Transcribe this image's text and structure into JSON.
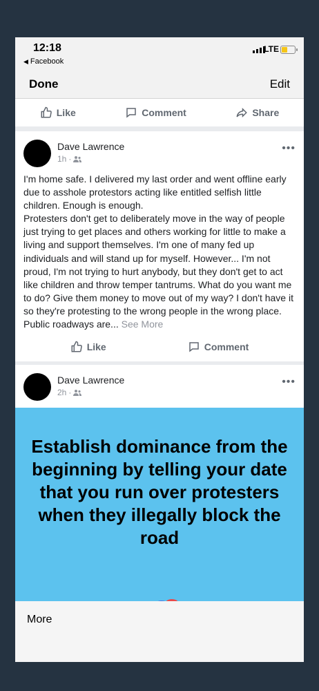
{
  "status": {
    "time": "12:18",
    "back_app": "Facebook",
    "network": "LTE"
  },
  "nav": {
    "done_label": "Done",
    "edit_label": "Edit"
  },
  "top_actions": {
    "like": "Like",
    "comment": "Comment",
    "share": "Share"
  },
  "post1": {
    "author": "Dave Lawrence",
    "time": "1h",
    "paragraphs": [
      "I'm home safe. I delivered my last order and went offline early due to asshole protestors acting like entitled selfish little children. Enough is enough.",
      "Protesters don't get to deliberately move in the way of people just trying to get places and others working for little to make a living and support themselves. I'm one of many fed up individuals and will stand up for myself. However... I'm not proud, I'm not trying to hurt anybody, but they don't get to act like children and throw temper tantrums. What do you want me to do? Give them money to move out of my way? I don't have it so they're protesting to the wrong people in the wrong place. Public roadways are..."
    ],
    "see_more": "See More",
    "like": "Like",
    "comment": "Comment"
  },
  "post2": {
    "author": "Dave Lawrence",
    "time": "2h",
    "image_text": "Establish dominance from the beginning by telling your date that you run over protesters when they illegally block the road"
  },
  "sheet": {
    "more_label": "More"
  },
  "icons": {
    "like": "thumbs-up-icon",
    "comment": "comment-bubble-icon",
    "share": "share-arrow-icon",
    "privacy": "friends-icon",
    "menu": "more-dots-icon"
  }
}
